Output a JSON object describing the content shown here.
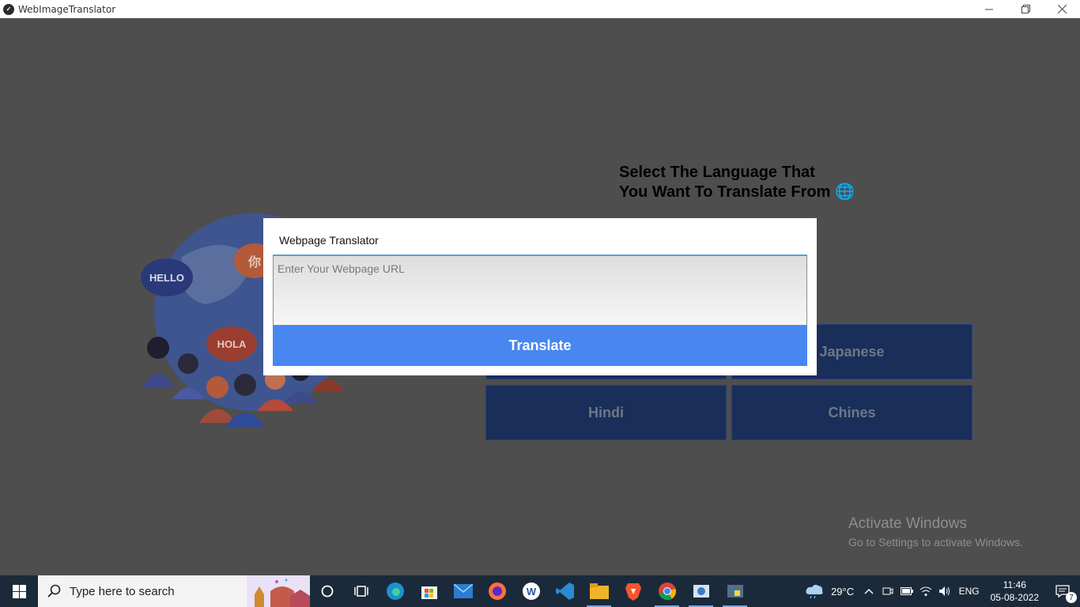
{
  "window": {
    "title": "WebImageTranslator",
    "app_icon": "kivy-logo-icon",
    "controls": [
      "minimize-icon",
      "restore-icon",
      "close-icon"
    ]
  },
  "main": {
    "heading_line1": "Select The Language That",
    "heading_line2": "You Want To Translate From 🌐",
    "illustration": {
      "bubble_hello": "HELLO",
      "bubble_hola": "HOLA",
      "bubble_ni": "你"
    },
    "languages": [
      {
        "label": "Japanese"
      },
      {
        "label": "Hindi"
      },
      {
        "label": "Chines"
      }
    ]
  },
  "dialog": {
    "title": "Webpage Translator",
    "url_placeholder": "Enter Your Webpage URL",
    "url_value": "",
    "translate_label": "Translate",
    "accent": "#4886f0"
  },
  "watermark": {
    "title": "Activate Windows",
    "subtitle": "Go to Settings to activate Windows."
  },
  "taskbar": {
    "search_placeholder": "Type here to search",
    "apps": [
      "cortana-icon",
      "task-view-icon",
      "edge-icon",
      "store-icon",
      "mail-icon",
      "firefox-icon",
      "word-icon",
      "vscode-icon",
      "file-explorer-icon",
      "brave-icon",
      "chrome-icon",
      "app-icon",
      "python-icon"
    ],
    "weather": "29°C",
    "language": "ENG",
    "time": "11:46",
    "date": "05-08-2022",
    "notifications": "7"
  }
}
